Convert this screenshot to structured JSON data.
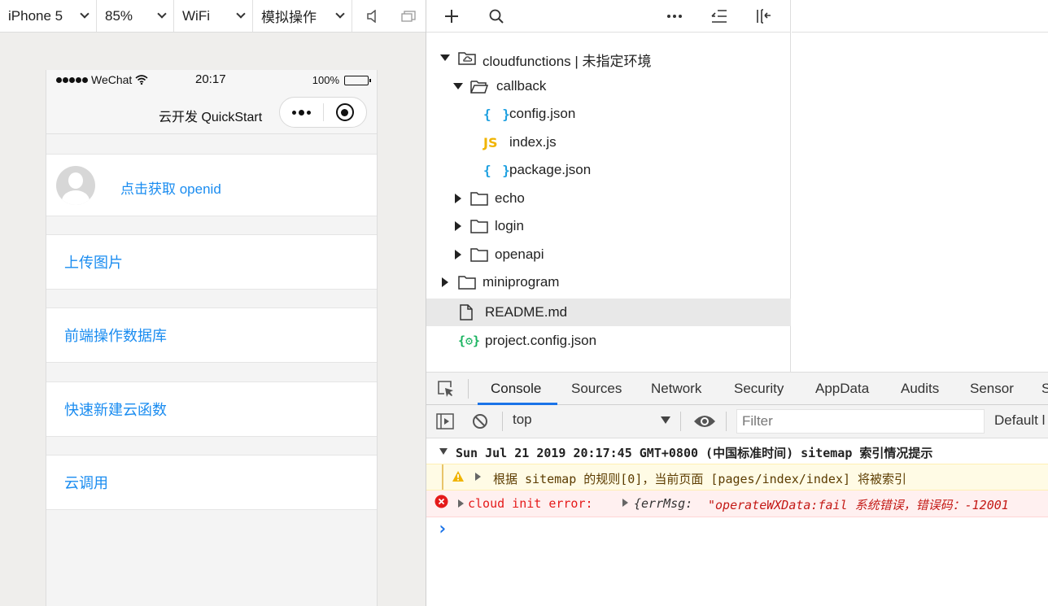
{
  "simulator": {
    "device": "iPhone 5",
    "zoom": "85%",
    "network": "WiFi",
    "operation": "模拟操作"
  },
  "phone": {
    "carrier": "WeChat",
    "time": "20:17",
    "battery": "100%",
    "battery_level": 1.0,
    "nav_title": "云开发 QuickStart",
    "openid_link": "点击获取 openid",
    "menu": [
      "上传图片",
      "前端操作数据库",
      "快速新建云函数",
      "云调用"
    ]
  },
  "file_tree": {
    "root": "cloudfunctions | 未指定环境",
    "callback": "callback",
    "callback_files": [
      "config.json",
      "index.js",
      "package.json"
    ],
    "json_icon": "{ }",
    "js_icon": "JS",
    "folders": [
      "echo",
      "login",
      "openapi"
    ],
    "miniprogram": "miniprogram",
    "readme": "README.md",
    "project_config": "project.config.json",
    "config_icon": "{⚙}"
  },
  "devtools": {
    "tabs": [
      "Console",
      "Sources",
      "Network",
      "Security",
      "AppData",
      "Audits",
      "Sensor",
      "S"
    ],
    "context": "top",
    "filter_placeholder": "Filter",
    "levels": "Default l",
    "logs": {
      "group": "Sun Jul 21 2019 20:17:45 GMT+0800 (中国标准时间) sitemap 索引情况提示",
      "warn": "根据 sitemap 的规则[0]，当前页面 [pages/index/index] 将被索引",
      "error_label": "cloud init error:",
      "error_obj_key": "{errMsg: ",
      "error_obj_value": "\"operateWXData:fail 系统错误，错误码：-12001",
      "prompt": "›"
    }
  },
  "colors": {
    "link": "#1a8cf0",
    "accent": "#1a73e8",
    "warn_bg": "#fffbe5",
    "error_bg": "#fff0f0",
    "error_text": "#e51a1a"
  }
}
